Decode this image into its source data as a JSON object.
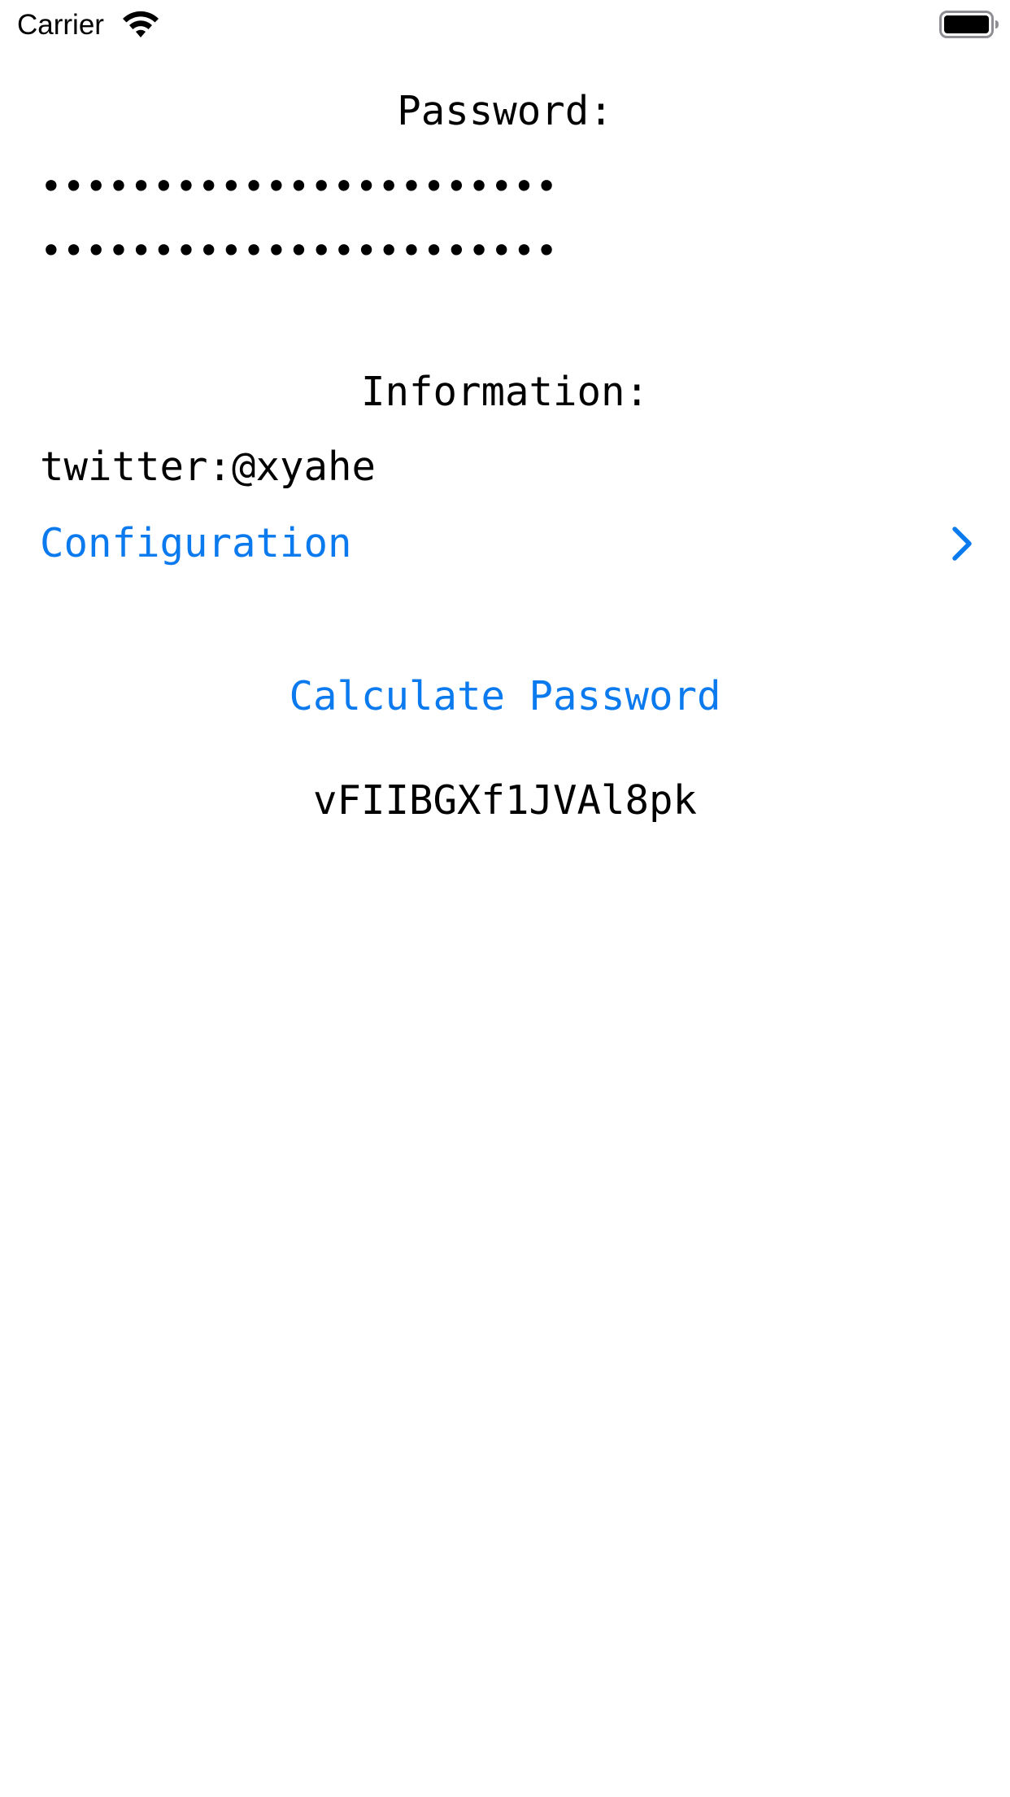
{
  "status_bar": {
    "carrier": "Carrier",
    "wifi_icon": "wifi-icon",
    "battery_icon": "battery-icon"
  },
  "password_section": {
    "title": "Password:",
    "field_1_value": "•••••••••••••••••••••••",
    "field_2_value": "•••••••••••••••••••••••"
  },
  "information_section": {
    "title": "Information:",
    "value": "twitter:@xyahe"
  },
  "configuration": {
    "label": "Configuration",
    "icon": "chevron-right-icon"
  },
  "calculate_button": {
    "label": "Calculate Password"
  },
  "result": {
    "value": "vFIIBGXf1JVAl8pk"
  },
  "colors": {
    "accent": "#0a7aee",
    "text": "#000000",
    "background": "#ffffff"
  }
}
